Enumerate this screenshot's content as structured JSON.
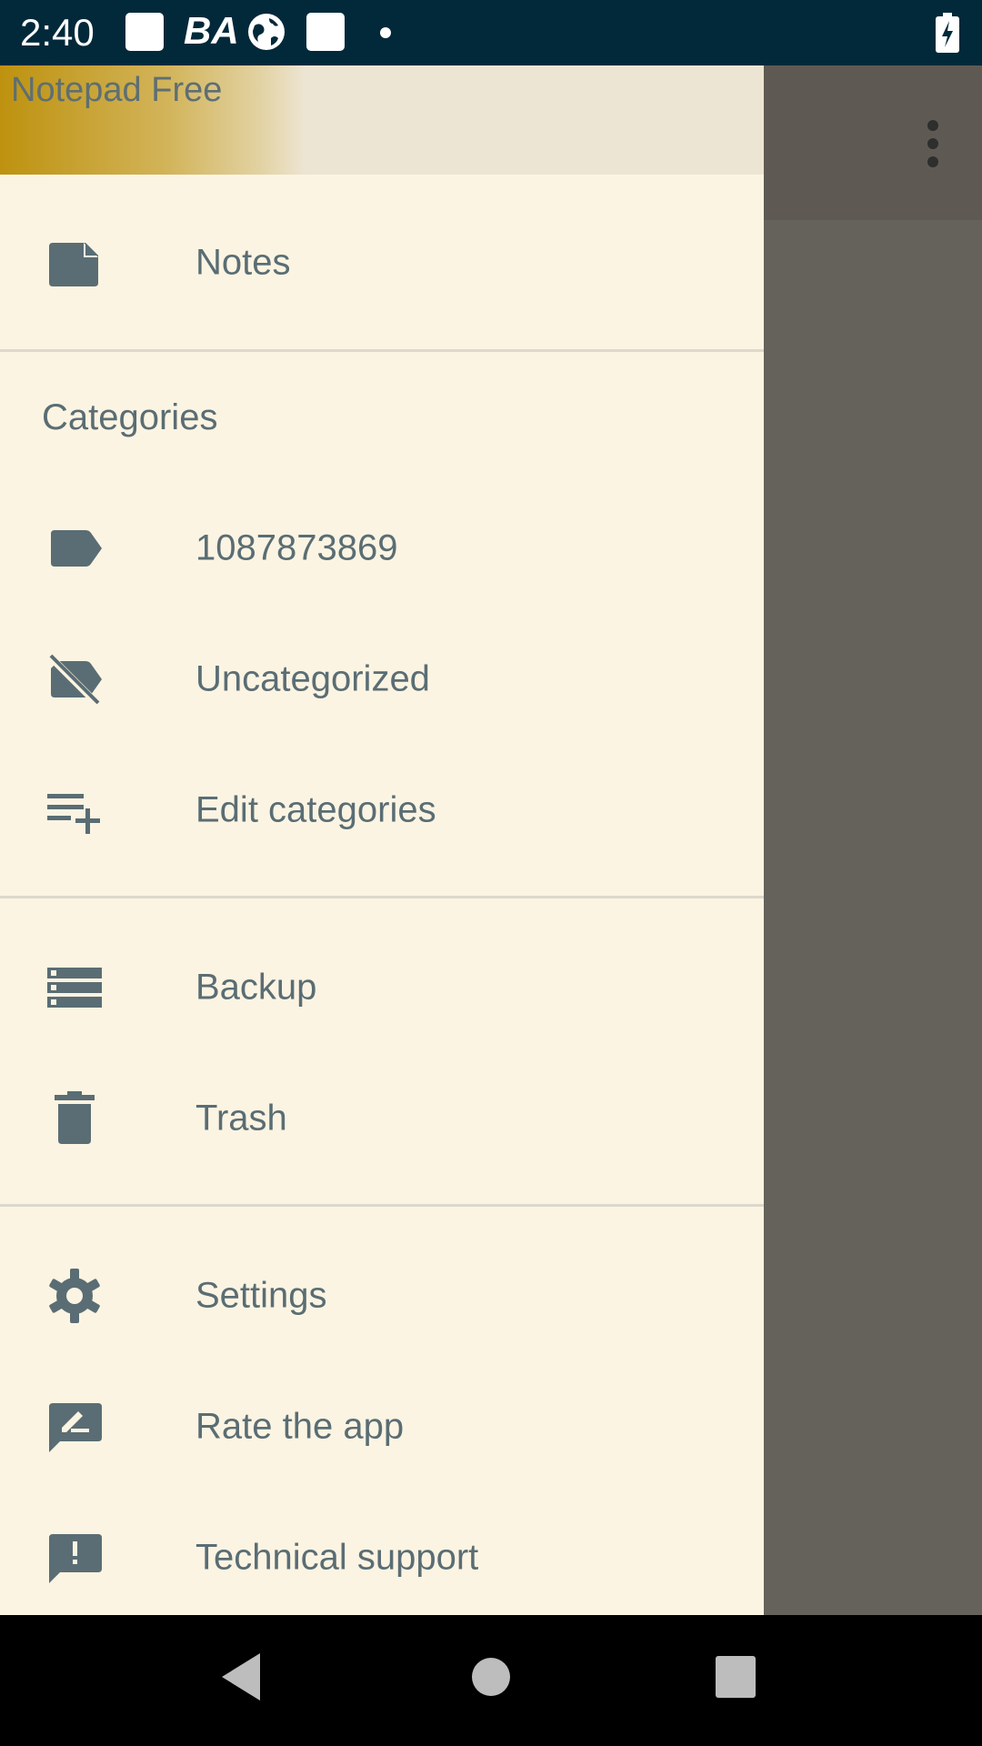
{
  "status_bar": {
    "time": "2:40",
    "icons": [
      "square-notification-icon",
      "ba-icon",
      "globe-icon",
      "square-notification-icon",
      "dot-icon",
      "battery-charging-icon"
    ],
    "ba_text": "BA"
  },
  "app": {
    "overflow_icon": "more-vert-icon"
  },
  "drawer": {
    "title": "Notepad Free",
    "items": {
      "notes": {
        "label": "Notes",
        "icon": "note-icon"
      },
      "category_1": {
        "label": "1087873869",
        "icon": "label-icon"
      },
      "uncategorized": {
        "label": "Uncategorized",
        "icon": "label-off-icon"
      },
      "edit_categories": {
        "label": "Edit categories",
        "icon": "playlist-add-icon"
      },
      "backup": {
        "label": "Backup",
        "icon": "storage-icon"
      },
      "trash": {
        "label": "Trash",
        "icon": "trash-icon"
      },
      "settings": {
        "label": "Settings",
        "icon": "gear-icon"
      },
      "rate": {
        "label": "Rate the app",
        "icon": "rate-review-icon"
      },
      "support": {
        "label": "Technical support",
        "icon": "feedback-icon"
      }
    },
    "categories_header": "Categories"
  },
  "nav_bar": {
    "icons": [
      "back-icon",
      "home-icon",
      "recents-icon"
    ]
  },
  "colors": {
    "drawer_bg": "#FCF4E2",
    "text": "#5A6D74",
    "status_bar": "#02293A",
    "scrim": "#65625B",
    "accent": "#BE920F"
  }
}
